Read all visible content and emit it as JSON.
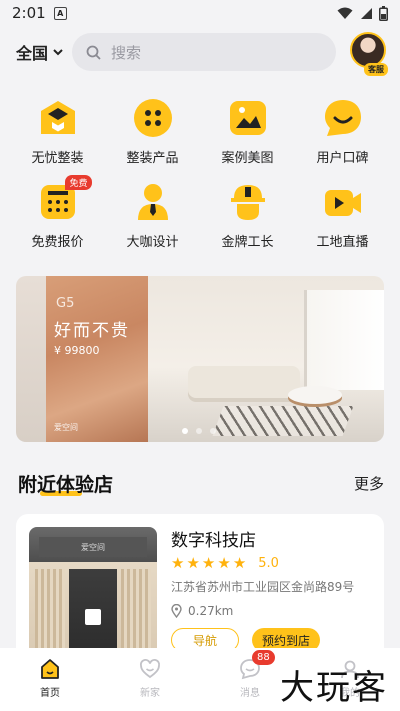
{
  "status_bar": {
    "time": "2:01",
    "app_icon_letter": "A"
  },
  "header": {
    "region": "全国",
    "search_placeholder": "搜索",
    "avatar_badge": "客服"
  },
  "grid": [
    {
      "label": "无忧整装",
      "icon": "house-icon"
    },
    {
      "label": "整装产品",
      "icon": "dots-icon"
    },
    {
      "label": "案例美图",
      "icon": "picture-icon"
    },
    {
      "label": "用户口碑",
      "icon": "smile-chat-icon"
    },
    {
      "label": "免费报价",
      "icon": "calculator-icon",
      "tag": "免费"
    },
    {
      "label": "大咖设计",
      "icon": "designer-icon"
    },
    {
      "label": "金牌工长",
      "icon": "helmet-icon"
    },
    {
      "label": "工地直播",
      "icon": "video-icon"
    }
  ],
  "banner": {
    "model": "G5",
    "title": "好而不贵",
    "price": "¥ 99800",
    "logo_text": "爱空间"
  },
  "nearby": {
    "title": "附近体验店",
    "more": "更多"
  },
  "store": {
    "name": "数字科技店",
    "rating": "5.0",
    "stars": 5,
    "address": "江苏省苏州市工业园区金尚路89号",
    "distance": "0.27km",
    "nav_button": "导航",
    "book_button": "预约到店",
    "sign_text": "爱空间"
  },
  "tabbar": [
    {
      "label": "首页",
      "icon": "home-icon",
      "active": true
    },
    {
      "label": "新家",
      "icon": "heart-icon",
      "active": false
    },
    {
      "label": "消息",
      "icon": "message-icon",
      "active": false,
      "badge": "88"
    },
    {
      "label": "我的",
      "icon": "user-icon",
      "active": false
    }
  ],
  "watermark": "大玩客",
  "colors": {
    "accent": "#ffc21a",
    "badge": "#e83b2e"
  }
}
